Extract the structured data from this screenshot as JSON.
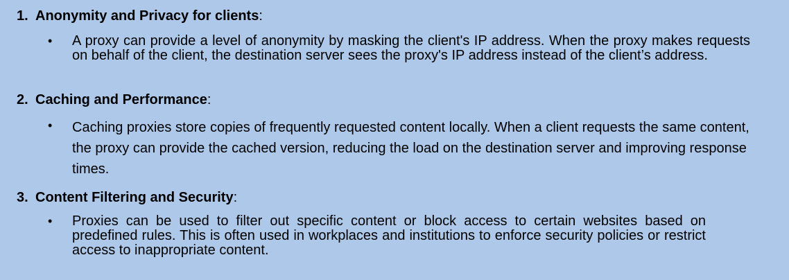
{
  "sections": [
    {
      "number": "1.",
      "title": "Anonymity and Privacy for clients",
      "suffix": ":",
      "bullet_symbol": "•",
      "bullet_text": "A proxy can provide a level of anonymity by masking the client's IP address. When the proxy makes requests on behalf of the client, the destination server sees the proxy's IP address instead of the client’s address."
    },
    {
      "number": "2.",
      "title": "Caching and Performance",
      "suffix": ":",
      "bullet_symbol": "•",
      "bullet_text": "Caching proxies store copies of frequently requested content locally. When a client requests the same content, the proxy can provide the cached version, reducing the load on the destination server and improving response times."
    },
    {
      "number": "3.",
      "title": "Content Filtering and Security",
      "suffix": ":",
      "bullet_symbol": "•",
      "bullet_text": "Proxies can be used to filter out specific content or block access to certain websites based on predefined rules. This is often used in workplaces and institutions to enforce security policies or restrict access to inappropriate content."
    }
  ],
  "colors": {
    "background": "#adc8e8",
    "text": "#000000"
  }
}
